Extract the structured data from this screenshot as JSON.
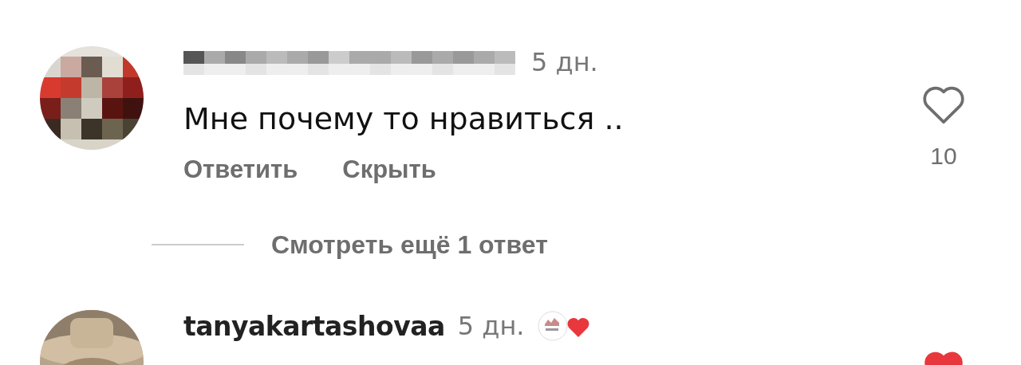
{
  "comments": [
    {
      "username_redacted": true,
      "time": "5 дн.",
      "text": "Мне почему то нравиться ..",
      "actions": [
        "Ответить",
        "Скрыть"
      ],
      "liked": false,
      "like_count": "10",
      "more_replies": "Смотреть ещё 1 ответ"
    },
    {
      "username": "tanyakartashovaa",
      "time": "5 дн.",
      "liked_by_author": true,
      "liked": true
    }
  ]
}
